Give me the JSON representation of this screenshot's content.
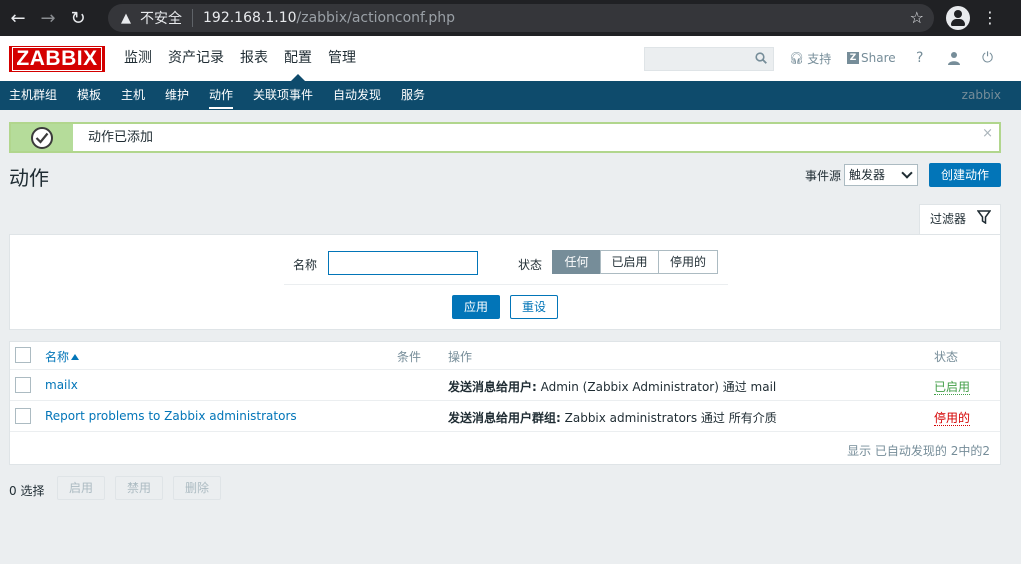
{
  "browser": {
    "insecure_label": "不安全",
    "url_host": "192.168.1.10",
    "url_path": "/zabbix/actionconf.php"
  },
  "header": {
    "logo": "ZABBIX",
    "menu": [
      "监测",
      "资产记录",
      "报表",
      "配置",
      "管理"
    ],
    "active_menu": "配置",
    "support": "支持",
    "share": "Share",
    "help": "?"
  },
  "submenu": {
    "items": [
      "主机群组",
      "模板",
      "主机",
      "维护",
      "动作",
      "关联项事件",
      "自动发现",
      "服务"
    ],
    "active": "动作",
    "server_name": "zabbix"
  },
  "message": {
    "text": "动作已添加",
    "close": "×"
  },
  "page": {
    "title": "动作",
    "event_source_label": "事件源",
    "event_source_value": "触发器",
    "create_button": "创建动作"
  },
  "filter": {
    "tab_label": "过滤器",
    "name_label": "名称",
    "name_value": "",
    "status_label": "状态",
    "status_options": [
      "任何",
      "已启用",
      "停用的"
    ],
    "status_selected": "任何",
    "apply": "应用",
    "reset": "重设"
  },
  "table": {
    "columns": [
      "名称",
      "条件",
      "操作",
      "状态"
    ],
    "rows": [
      {
        "name": "mailx",
        "conditions": "",
        "op_bold": "发送消息给用户:",
        "op_rest": " Admin (Zabbix Administrator) 通过 mail",
        "status": "已启用"
      },
      {
        "name": "Report problems to Zabbix administrators",
        "conditions": "",
        "op_bold": "发送消息给用户群组:",
        "op_rest": " Zabbix administrators 通过 所有介质",
        "status": "停用的"
      }
    ],
    "paging": "显示 已自动发现的 2中的2"
  },
  "footer": {
    "selected": "0 选择",
    "enable": "启用",
    "disable": "禁用",
    "delete": "删除"
  },
  "colors": {
    "brand_red": "#d40000",
    "nav_blue": "#0e4b6c",
    "link_blue": "#0275b8",
    "enabled_green": "#429e47",
    "disabled_red": "#d40000"
  }
}
